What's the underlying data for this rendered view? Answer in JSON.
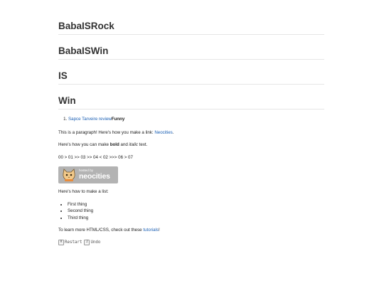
{
  "headings": [
    "BabaISRock",
    "BabaISWin",
    "IS",
    "Win"
  ],
  "review": {
    "link_label": "Sapce Tarveire review",
    "funny_label": "Funny"
  },
  "intro": {
    "text_before": "This is a paragraph! Here's how you make a link: ",
    "link_label": "Neocities",
    "text_after": "."
  },
  "formatting": {
    "text_before": "Here's how you can make ",
    "bold_label": "bold",
    "text_middle": " and ",
    "italic_label": "italic",
    "text_after": " text."
  },
  "sequence": "00 > 01 >> 03 >> 04 < 02 >>> 06 > 07",
  "badge": {
    "small_text": "hosted by",
    "big_text": "neocities",
    "icon": "neocities-cat-icon"
  },
  "list_intro": "Here's how to make a list:",
  "list_items": [
    "First thing",
    "Second thing",
    "Third thing"
  ],
  "learn_more": {
    "text_before": "To learn more HTML/CSS, check out these ",
    "link_label": "tutorials",
    "text_after": "!"
  },
  "controls": {
    "restart_key": "R",
    "restart_label": "Restart",
    "undo_key": "Z",
    "undo_label": "Undo"
  },
  "colors": {
    "link": "#1a5fb4",
    "badge_bg": "#b3b3b3",
    "divider": "#e6e6e6"
  }
}
